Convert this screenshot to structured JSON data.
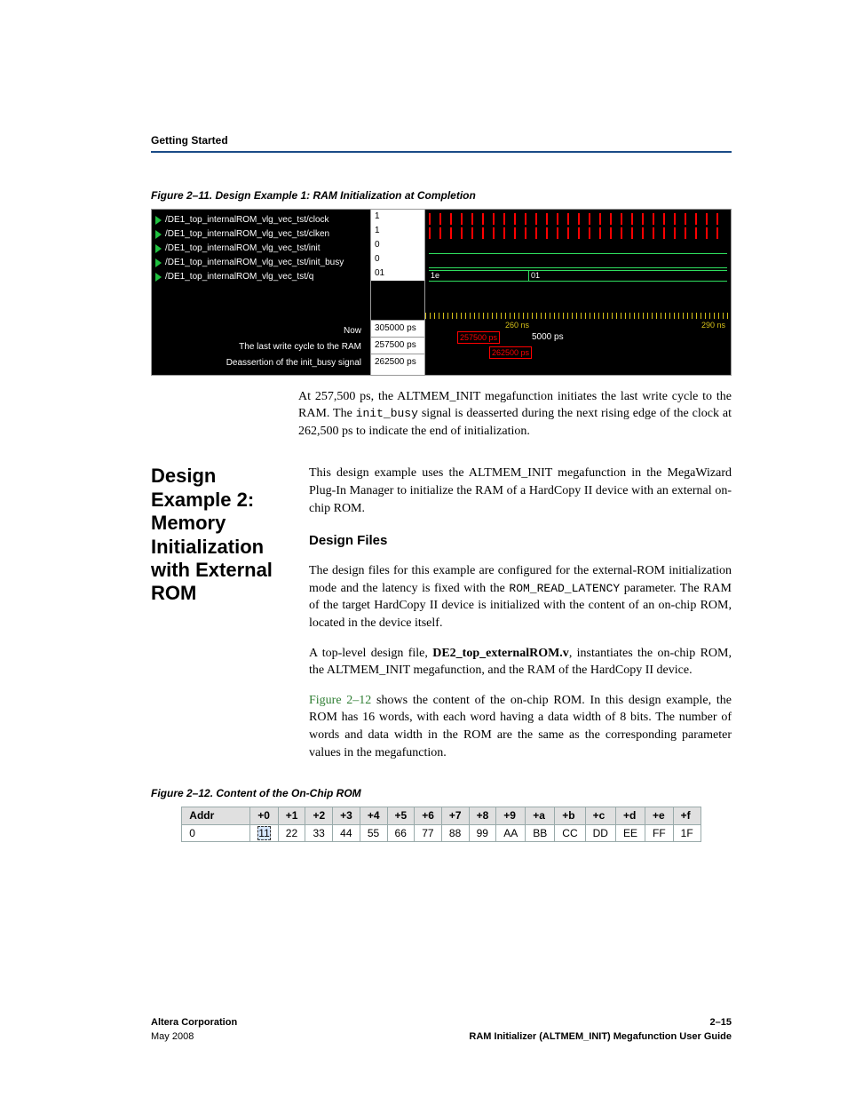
{
  "header": {
    "section": "Getting Started"
  },
  "fig11": {
    "caption": "Figure 2–11. Design Example 1: RAM Initialization at Completion",
    "signals": [
      {
        "name": "/DE1_top_internalROM_vlg_vec_tst/clock",
        "val": "1"
      },
      {
        "name": "/DE1_top_internalROM_vlg_vec_tst/clken",
        "val": "1"
      },
      {
        "name": "/DE1_top_internalROM_vlg_vec_tst/init",
        "val": "0"
      },
      {
        "name": "/DE1_top_internalROM_vlg_vec_tst/init_busy",
        "val": "0"
      },
      {
        "name": "/DE1_top_internalROM_vlg_vec_tst/q",
        "val": "01"
      }
    ],
    "labels": [
      {
        "left": "Now",
        "mid": "305000 ps"
      },
      {
        "left": "The last write cycle to the RAM",
        "mid": "257500 ps"
      },
      {
        "left": "Deassertion of the init_busy signal",
        "mid": "262500 ps"
      }
    ],
    "ruler": {
      "t1": "260 ns",
      "t2": "290 ns"
    },
    "cursors": {
      "c1": "257500 ps",
      "c2": "262500 ps",
      "gap": "5000 ps"
    },
    "bus": {
      "a": "1e",
      "b": "01"
    }
  },
  "para1a": "At 257,500 ps, the ALTMEM_INIT megafunction initiates the last write cycle to the RAM. The ",
  "para1b": "init_busy",
  "para1c": " signal is deasserted during the next rising edge of the clock at 262,500 ps to indicate the end of initialization.",
  "sideHead": "Design Example 2: Memory Initialization with External ROM",
  "para2": "This design example uses the ALTMEM_INIT megafunction in the MegaWizard Plug-In Manager to initialize the RAM of a HardCopy II device with an external on-chip ROM.",
  "subDesignFiles": "Design Files",
  "para3a": "The design files for this example are configured for the external-ROM initialization mode and the latency is fixed with the ",
  "para3b": "ROM_READ_LATENCY",
  "para3c": " parameter. The RAM of the target HardCopy II device is initialized with the content of an on-chip ROM, located in the device itself.",
  "para4a": "A top-level design file, ",
  "para4b": "DE2_top_externalROM.v",
  "para4c": ", instantiates the on-chip ROM, the ALTMEM_INIT megafunction, and the RAM of the HardCopy II device.",
  "para5a": "Figure 2–12",
  "para5b": " shows the content of the on-chip ROM. In this design example, the ROM has 16 words, with each word having a data width of 8 bits. The number of words and data width in the ROM are the same as the corresponding parameter values in the megafunction.",
  "fig12": {
    "caption": "Figure 2–12. Content of the On-Chip ROM",
    "headers": [
      "Addr",
      "+0",
      "+1",
      "+2",
      "+3",
      "+4",
      "+5",
      "+6",
      "+7",
      "+8",
      "+9",
      "+a",
      "+b",
      "+c",
      "+d",
      "+e",
      "+f"
    ],
    "row": [
      "0",
      "11",
      "22",
      "33",
      "44",
      "55",
      "66",
      "77",
      "88",
      "99",
      "AA",
      "BB",
      "CC",
      "DD",
      "EE",
      "FF",
      "1F"
    ]
  },
  "footer": {
    "corp": "Altera Corporation",
    "date": "May 2008",
    "page": "2–15",
    "doc": "RAM Initializer (ALTMEM_INIT) Megafunction User Guide"
  }
}
